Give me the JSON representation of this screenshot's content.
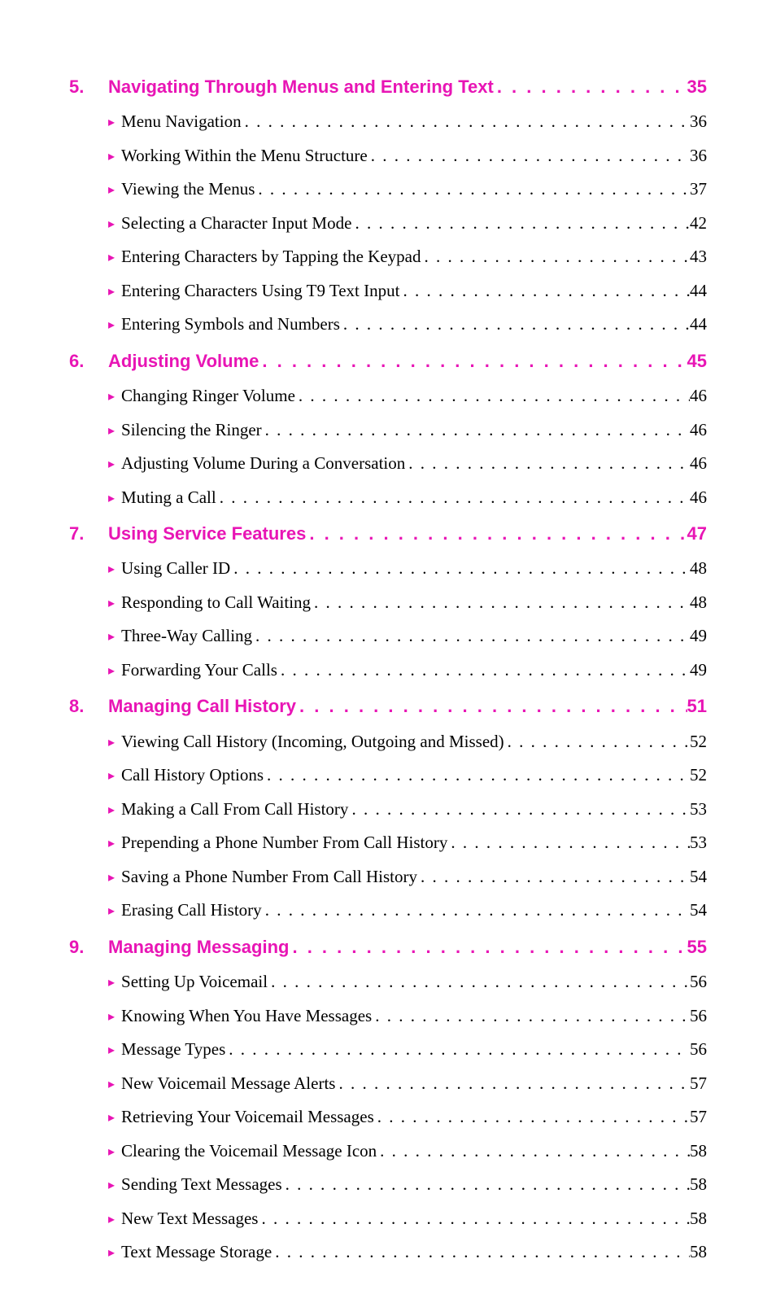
{
  "sections": [
    {
      "num": "5.",
      "title": "Navigating Through Menus and Entering Text",
      "page": "35",
      "items": [
        {
          "label": "Menu Navigation",
          "page": "36"
        },
        {
          "label": "Working Within the Menu Structure",
          "page": "36"
        },
        {
          "label": "Viewing the Menus",
          "page": "37"
        },
        {
          "label": "Selecting a Character Input Mode",
          "page": "42"
        },
        {
          "label": "Entering Characters by Tapping the Keypad",
          "page": "43"
        },
        {
          "label": "Entering Characters Using T9 Text Input",
          "page": "44"
        },
        {
          "label": "Entering Symbols and Numbers",
          "page": "44"
        }
      ]
    },
    {
      "num": "6.",
      "title": "Adjusting Volume",
      "page": "45",
      "items": [
        {
          "label": "Changing Ringer Volume",
          "page": "46"
        },
        {
          "label": "Silencing the Ringer",
          "page": "46"
        },
        {
          "label": "Adjusting Volume During a Conversation",
          "page": "46"
        },
        {
          "label": "Muting a Call",
          "page": "46"
        }
      ]
    },
    {
      "num": "7.",
      "title": "Using Service Features",
      "page": "47",
      "items": [
        {
          "label": "Using Caller ID",
          "page": "48"
        },
        {
          "label": "Responding to Call Waiting",
          "page": "48"
        },
        {
          "label": "Three-Way Calling",
          "page": "49"
        },
        {
          "label": "Forwarding Your Calls",
          "page": "49"
        }
      ]
    },
    {
      "num": "8.",
      "title": "Managing Call History",
      "page": "51",
      "items": [
        {
          "label": "Viewing Call History (Incoming, Outgoing and Missed)",
          "page": "52"
        },
        {
          "label": "Call History Options",
          "page": "52"
        },
        {
          "label": "Making a Call From Call History",
          "page": "53"
        },
        {
          "label": "Prepending a Phone Number From Call History",
          "page": "53"
        },
        {
          "label": "Saving a Phone Number From Call History",
          "page": "54"
        },
        {
          "label": "Erasing Call History",
          "page": "54"
        }
      ]
    },
    {
      "num": "9.",
      "title": "Managing Messaging",
      "page": "55",
      "items": [
        {
          "label": "Setting Up Voicemail",
          "page": "56"
        },
        {
          "label": "Knowing When You Have Messages",
          "page": "56"
        },
        {
          "label": "Message Types",
          "page": "56"
        },
        {
          "label": "New Voicemail Message Alerts",
          "page": "57"
        },
        {
          "label": "Retrieving Your Voicemail Messages",
          "page": "57"
        },
        {
          "label": "Clearing the Voicemail Message Icon",
          "page": "58"
        },
        {
          "label": "Sending Text Messages",
          "page": "58"
        },
        {
          "label": "New Text Messages",
          "page": "58"
        },
        {
          "label": "Text Message Storage",
          "page": "58"
        }
      ]
    }
  ],
  "dots": ". . . . . . . . . . . . . . . . . . . . . . . . . . . . . . . . . . . . . . . . . . . . . . . . . . . . . . . . . . . . . . . . . . . . . . . . . . . . . ."
}
